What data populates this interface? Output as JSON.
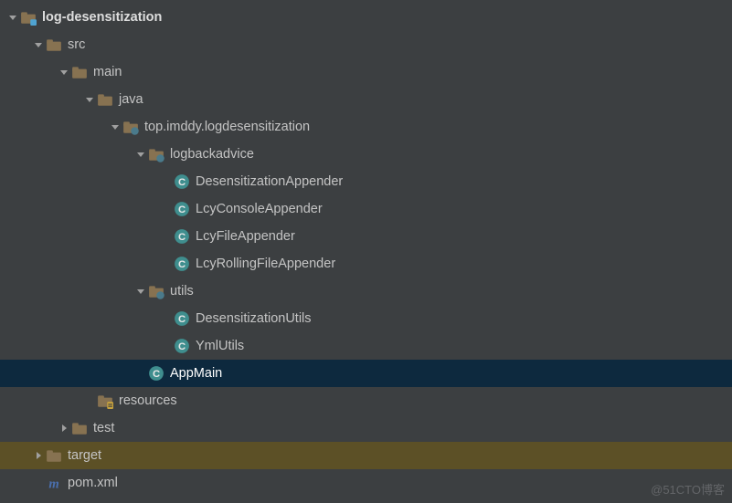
{
  "tree": {
    "root": {
      "label": "log-desensitization"
    },
    "src": {
      "label": "src"
    },
    "main": {
      "label": "main"
    },
    "java": {
      "label": "java"
    },
    "pkg": {
      "label": "top.imddy.logdesensitization"
    },
    "logback": {
      "label": "logbackadvice"
    },
    "c1": {
      "label": "DesensitizationAppender"
    },
    "c2": {
      "label": "LcyConsoleAppender"
    },
    "c3": {
      "label": "LcyFileAppender"
    },
    "c4": {
      "label": "LcyRollingFileAppender"
    },
    "utils": {
      "label": "utils"
    },
    "c5": {
      "label": "DesensitizationUtils"
    },
    "c6": {
      "label": "YmlUtils"
    },
    "c7": {
      "label": "AppMain"
    },
    "res": {
      "label": "resources"
    },
    "test": {
      "label": "test"
    },
    "target": {
      "label": "target"
    },
    "pom": {
      "label": "pom.xml"
    }
  },
  "watermark": "@51CTO博客"
}
